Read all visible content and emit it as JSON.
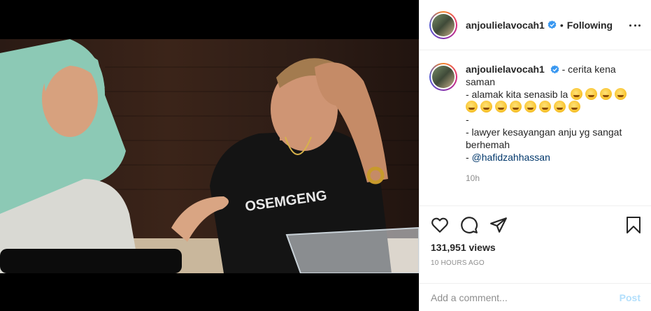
{
  "post": {
    "username": "anjoulielavocah1",
    "follow_state": "Following",
    "separator": "•"
  },
  "caption": {
    "username": "anjoulielavocah1",
    "line1": " - cerita kena saman",
    "line2": "- alamak kita senasib la ",
    "line4": "-",
    "line5": "- lawyer kesayangan anju yg sangat berhemah",
    "line6_prefix": "- ",
    "mention": "@hafidzahhassan",
    "time": "10h",
    "rofl_emoji_count_line2": 4,
    "rofl_emoji_count_line3": 8
  },
  "stats": {
    "views": "131,951 views",
    "posted_ago": "10 HOURS AGO"
  },
  "comment_box": {
    "placeholder": "Add a comment...",
    "post_label": "Post"
  },
  "icons": {
    "like": "heart-icon",
    "comment": "comment-icon",
    "share": "share-icon",
    "save": "bookmark-icon",
    "more": "more-options-icon",
    "verified": "verified-badge-icon"
  },
  "colors": {
    "verified_blue": "#3897f0",
    "post_disabled": "#b2dffc",
    "mention": "#00376b",
    "muted": "#8e8e8e"
  }
}
